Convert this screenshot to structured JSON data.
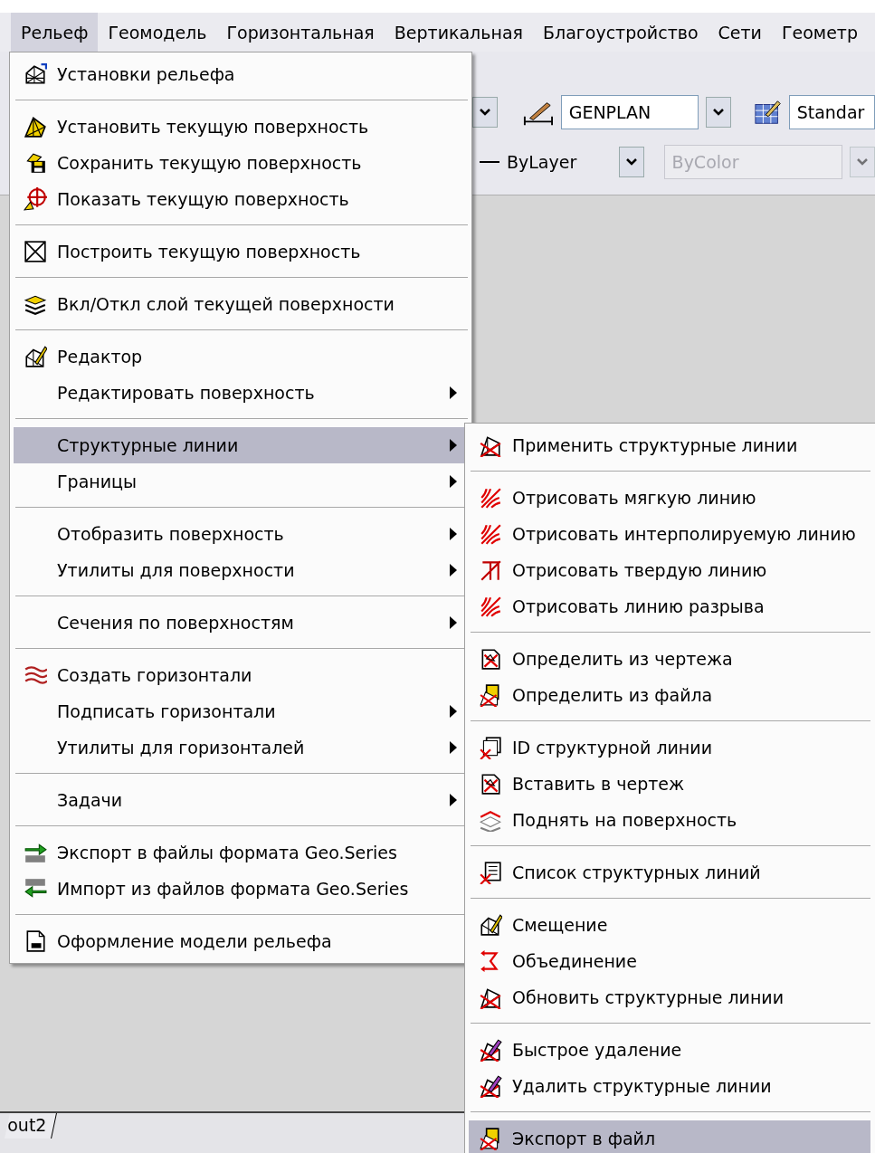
{
  "menubar": [
    {
      "label": "Рельеф",
      "selected": true
    },
    {
      "label": "Геомодель",
      "selected": false
    },
    {
      "label": "Горизонтальная",
      "selected": false
    },
    {
      "label": "Вертикальная",
      "selected": false
    },
    {
      "label": "Благоустройство",
      "selected": false
    },
    {
      "label": "Сети",
      "selected": false
    },
    {
      "label": "Геометр",
      "selected": false
    }
  ],
  "toolbar": {
    "layer_field": {
      "value": "GENPLAN"
    },
    "style_field": {
      "value": "Standar"
    },
    "linetype_field": {
      "value": "ByLayer"
    },
    "color_field": {
      "value": "ByColor",
      "disabled": true
    }
  },
  "menu": {
    "items": [
      {
        "kind": "item",
        "label": "Установки рельефа",
        "submenu": false,
        "selected": false
      },
      {
        "kind": "separator"
      },
      {
        "kind": "item",
        "label": "Установить текущую поверхность",
        "submenu": false,
        "selected": false
      },
      {
        "kind": "item",
        "label": "Сохранить текущую поверхность",
        "submenu": false,
        "selected": false
      },
      {
        "kind": "item",
        "label": "Показать текущую поверхность",
        "submenu": false,
        "selected": false
      },
      {
        "kind": "separator"
      },
      {
        "kind": "item",
        "label": "Построить текущую поверхность",
        "submenu": false,
        "selected": false
      },
      {
        "kind": "separator"
      },
      {
        "kind": "item",
        "label": "Вкл/Откл слой текущей поверхности",
        "submenu": false,
        "selected": false
      },
      {
        "kind": "separator"
      },
      {
        "kind": "item",
        "label": "Редактор",
        "submenu": false,
        "selected": false
      },
      {
        "kind": "item",
        "label": "Редактировать поверхность",
        "submenu": true,
        "selected": false
      },
      {
        "kind": "separator"
      },
      {
        "kind": "item",
        "label": "Структурные линии",
        "submenu": true,
        "selected": true
      },
      {
        "kind": "item",
        "label": "Границы",
        "submenu": true,
        "selected": false
      },
      {
        "kind": "separator"
      },
      {
        "kind": "item",
        "label": "Отобразить поверхность",
        "submenu": true,
        "selected": false
      },
      {
        "kind": "item",
        "label": "Утилиты для поверхности",
        "submenu": true,
        "selected": false
      },
      {
        "kind": "separator"
      },
      {
        "kind": "item",
        "label": "Сечения по поверхностям",
        "submenu": true,
        "selected": false
      },
      {
        "kind": "separator"
      },
      {
        "kind": "item",
        "label": "Создать горизонтали",
        "submenu": false,
        "selected": false
      },
      {
        "kind": "item",
        "label": "Подписать горизонтали",
        "submenu": true,
        "selected": false
      },
      {
        "kind": "item",
        "label": "Утилиты для горизонталей",
        "submenu": true,
        "selected": false
      },
      {
        "kind": "separator"
      },
      {
        "kind": "item",
        "label": "Задачи",
        "submenu": true,
        "selected": false
      },
      {
        "kind": "separator"
      },
      {
        "kind": "item",
        "label": "Экспорт в файлы формата Geo.Series",
        "submenu": false,
        "selected": false
      },
      {
        "kind": "item",
        "label": "Импорт из файлов формата Geo.Series",
        "submenu": false,
        "selected": false
      },
      {
        "kind": "separator"
      },
      {
        "kind": "item",
        "label": "Оформление модели рельефа",
        "submenu": false,
        "selected": false
      }
    ]
  },
  "submenu": {
    "items": [
      {
        "kind": "item",
        "label": "Применить структурные линии",
        "selected": false
      },
      {
        "kind": "separator"
      },
      {
        "kind": "item",
        "label": "Отрисовать мягкую линию",
        "selected": false
      },
      {
        "kind": "item",
        "label": "Отрисовать интерполируемую линию",
        "selected": false
      },
      {
        "kind": "item",
        "label": "Отрисовать твердую линию",
        "selected": false
      },
      {
        "kind": "item",
        "label": "Отрисовать линию разрыва",
        "selected": false
      },
      {
        "kind": "separator"
      },
      {
        "kind": "item",
        "label": "Определить из чертежа",
        "selected": false
      },
      {
        "kind": "item",
        "label": "Определить из файла",
        "selected": false
      },
      {
        "kind": "separator"
      },
      {
        "kind": "item",
        "label": "ID структурной линии",
        "selected": false
      },
      {
        "kind": "item",
        "label": "Вставить в чертеж",
        "selected": false
      },
      {
        "kind": "item",
        "label": "Поднять на поверхность",
        "selected": false
      },
      {
        "kind": "separator"
      },
      {
        "kind": "item",
        "label": "Список структурных линий",
        "selected": false
      },
      {
        "kind": "separator"
      },
      {
        "kind": "item",
        "label": "Смещение",
        "selected": false
      },
      {
        "kind": "item",
        "label": "Объединение",
        "selected": false
      },
      {
        "kind": "item",
        "label": "Обновить структурные линии",
        "selected": false
      },
      {
        "kind": "separator"
      },
      {
        "kind": "item",
        "label": "Быстрое удаление",
        "selected": false
      },
      {
        "kind": "item",
        "label": "Удалить структурные линии",
        "selected": false
      },
      {
        "kind": "separator"
      },
      {
        "kind": "item",
        "label": "Экспорт в файл",
        "selected": true
      }
    ]
  },
  "layout_tab": {
    "label": "out2"
  }
}
